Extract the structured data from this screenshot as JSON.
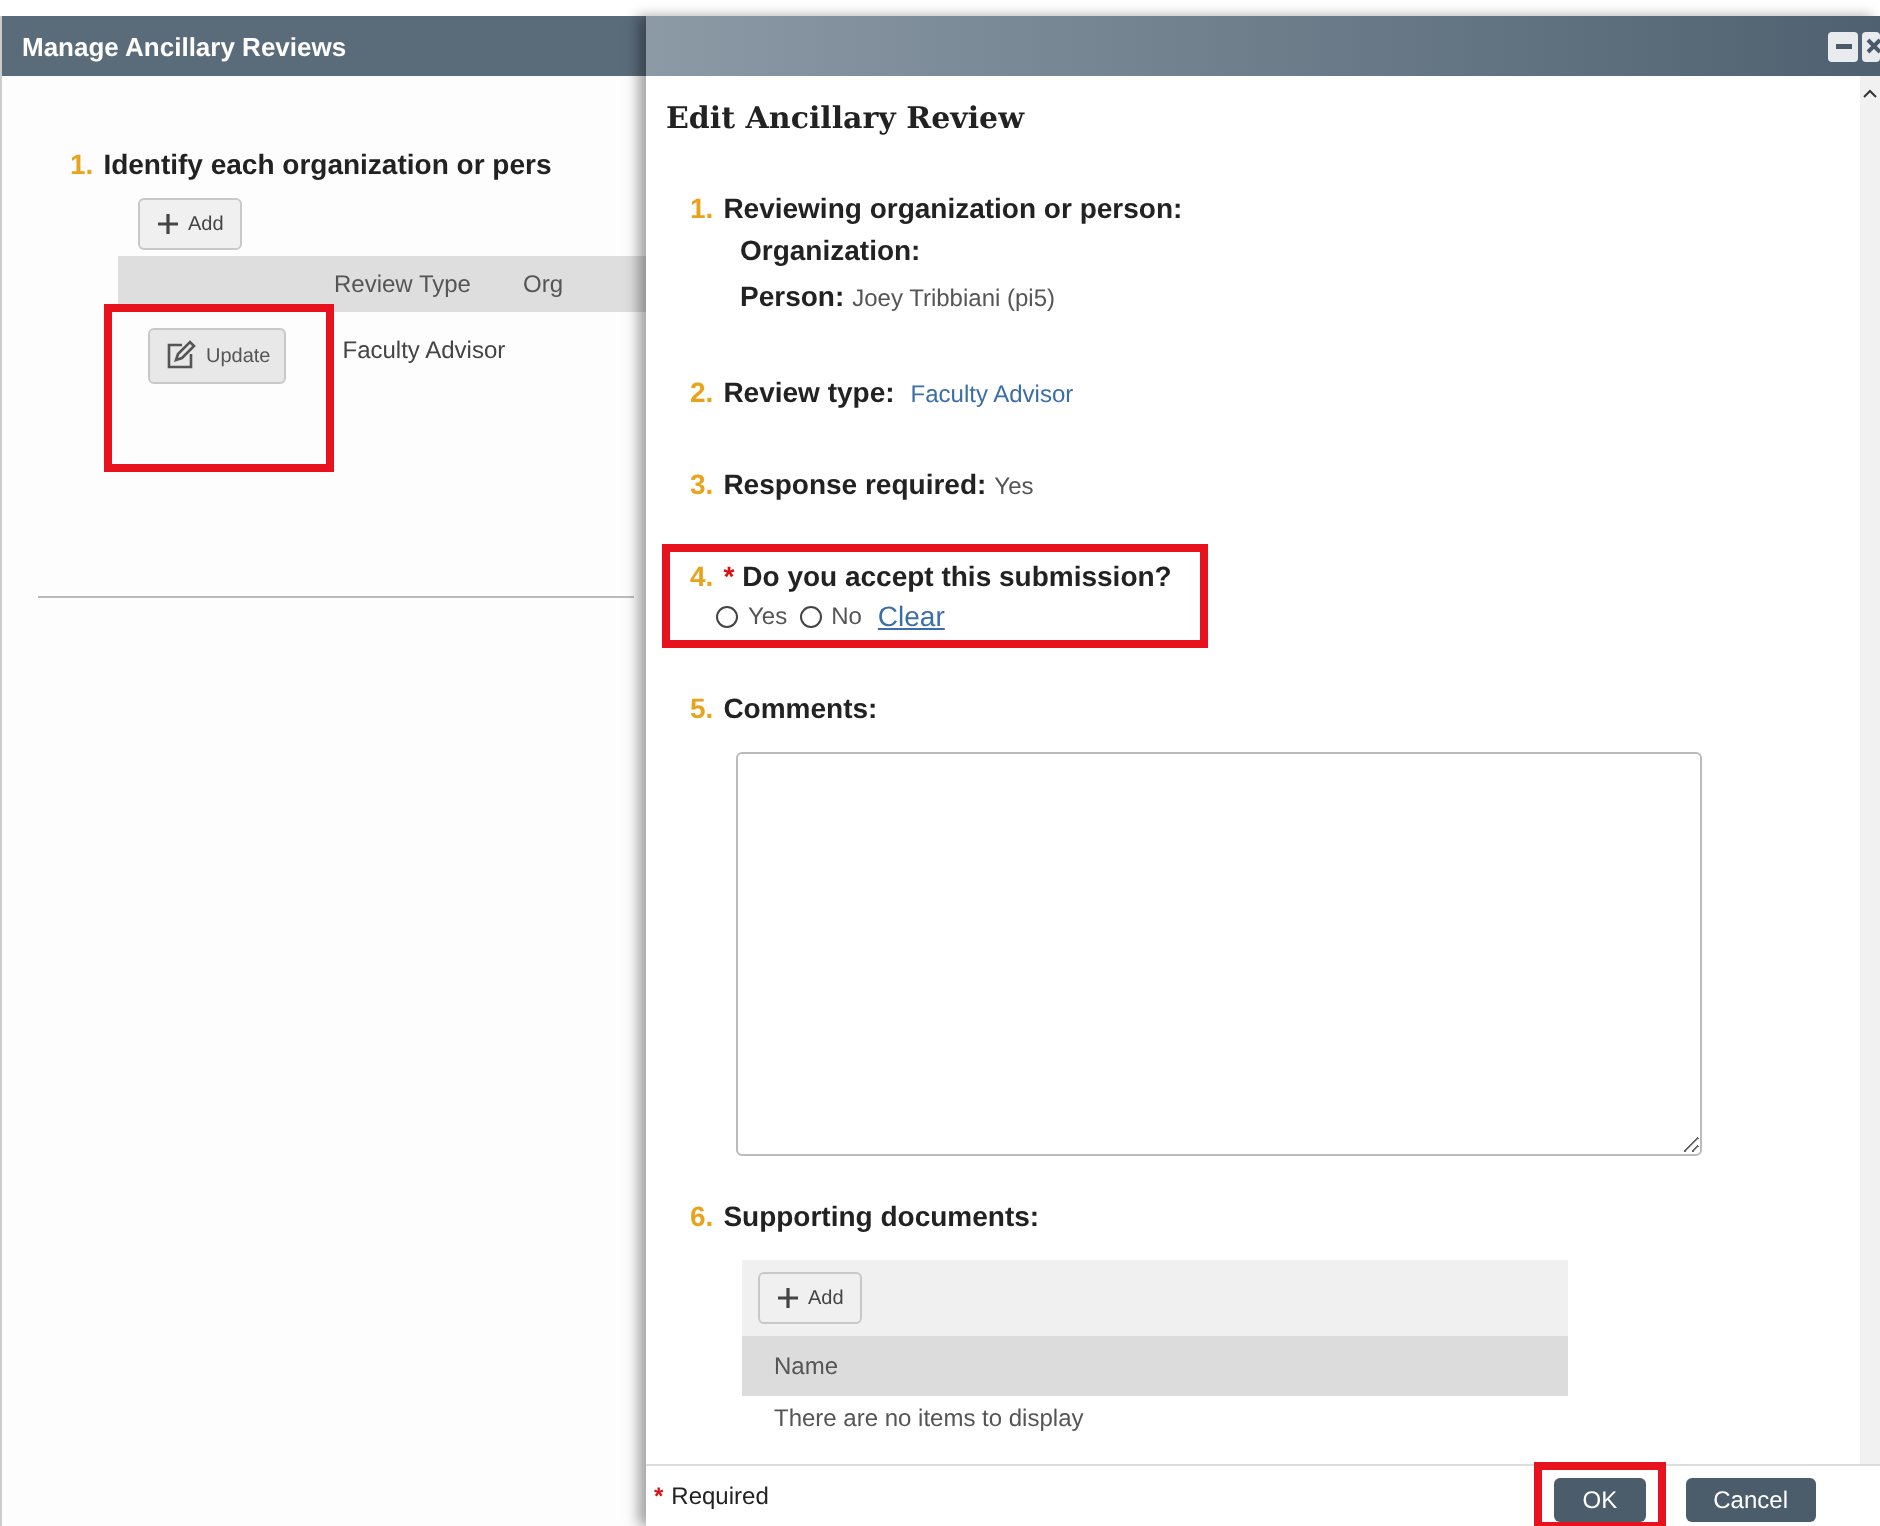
{
  "main_window": {
    "title": "Manage Ancillary Reviews",
    "question": {
      "number": "1.",
      "text": "Identify each organization or pers"
    },
    "add_button": "Add",
    "columns": [
      "Review Type",
      "Org"
    ],
    "rows": [
      {
        "action": "Update",
        "review_type": "Faculty Advisor",
        "highlighted": true
      }
    ]
  },
  "dialog": {
    "title": "Edit Ancillary Review",
    "questions": [
      {
        "kind": "reviewer",
        "number": "1.",
        "label": "Reviewing organization or person:",
        "organization_label": "Organization:",
        "person_label": "Person:",
        "person_value": "Joey Tribbiani (pi5)",
        "highlighted": false
      },
      {
        "kind": "value",
        "number": "2.",
        "label": "Review type:",
        "value": "Faculty Advisor",
        "link": true,
        "highlighted": false
      },
      {
        "kind": "value",
        "number": "3.",
        "label": "Response required:",
        "value": "Yes",
        "link": false,
        "highlighted": false
      },
      {
        "kind": "radio",
        "number": "4.",
        "required": true,
        "label": "Do you accept this submission?",
        "options": [
          {
            "label": "Yes",
            "selected": false
          },
          {
            "label": "No",
            "selected": false
          }
        ],
        "clear": "Clear",
        "highlighted": true
      },
      {
        "kind": "textarea",
        "number": "5.",
        "label": "Comments:",
        "highlighted": false
      },
      {
        "kind": "documents",
        "number": "6.",
        "label": "Supporting documents:",
        "add_button": "Add",
        "column": "Name",
        "empty": "There are no items to display",
        "highlighted": false
      }
    ],
    "footer": {
      "required_mark": "*",
      "required_text": "Required",
      "buttons": [
        {
          "label": "OK",
          "highlighted": true
        },
        {
          "label": "Cancel",
          "highlighted": false
        }
      ]
    }
  }
}
